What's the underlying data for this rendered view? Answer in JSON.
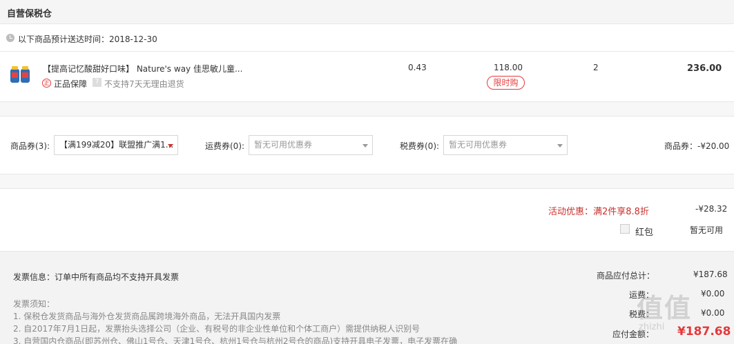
{
  "section_title": "自营保税仓",
  "delivery_text": "以下商品预计送达时间：2018-12-30",
  "product": {
    "name": "【提高记忆酸甜好口味】 Nature's way 佳思敏儿童...",
    "guarantee_badge": "正",
    "guarantee_label": "正品保障",
    "return_badge": "7",
    "return_label": "不支持7天无理由退货",
    "tax": "0.43",
    "price": "118.00",
    "promo_tag": "限时购",
    "quantity": "2",
    "subtotal": "236.00"
  },
  "coupons": {
    "goods_label": "商品券(3):",
    "goods_selected": "【满199减20】联盟推广满1...",
    "shipping_label": "运费券(0):",
    "shipping_placeholder": "暂无可用优惠券",
    "tax_label": "税费券(0):",
    "tax_placeholder": "暂无可用优惠券",
    "goods_discount": "商品券：-¥20.00"
  },
  "promotion": {
    "label": "活动优惠：满2件享8.8折",
    "amount": "-¥28.32",
    "redpacket_label": "红包",
    "redpacket_status": "暂无可用"
  },
  "invoice": {
    "info": "发票信息：订单中所有商品均不支持开具发票",
    "notice_title": "发票须知：",
    "notice_1": "1. 保税仓发货商品与海外仓发货商品属跨境海外商品，无法开具国内发票",
    "notice_2": "2. 自2017年7月1日起，发票抬头选择公司（企业、有税号的非企业性单位和个体工商户）需提供纳税人识别号",
    "notice_3": "3. 自营国内仓商品(即苏州仓、佛山1号仓、天津1号仓、杭州1号仓与杭州2号仓的商品)支持开具电子发票，电子发票在确"
  },
  "totals": {
    "goods_total_label": "商品应付总计：",
    "goods_total_value": "¥187.68",
    "shipping_label": "运费：",
    "shipping_value": "¥0.00",
    "tax_label": "税费：",
    "tax_value": "¥0.00",
    "payable_label": "应付金额：",
    "payable_value": "¥187.68"
  },
  "watermark": {
    "main": "值值",
    "sub": "zhizhi"
  },
  "colors": {
    "accent_red": "#e4393c",
    "promo_red": "#c9302c"
  }
}
